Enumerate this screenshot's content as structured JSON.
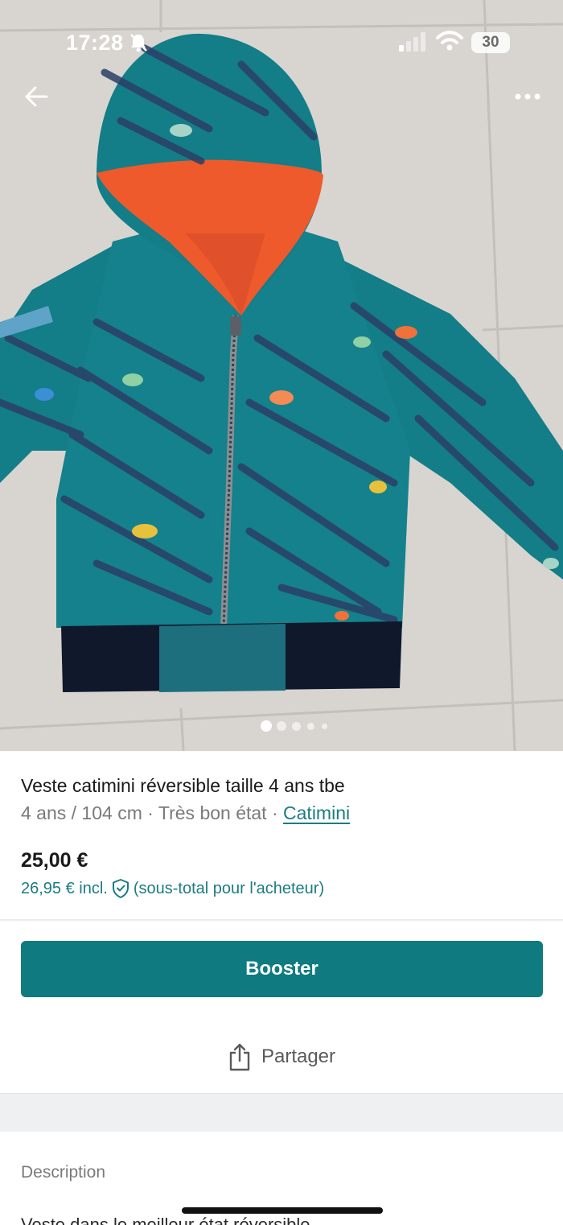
{
  "status_bar": {
    "time": "17:28",
    "battery": "30"
  },
  "photo": {
    "image_count": 5,
    "active_index": 0
  },
  "item": {
    "title": "Veste catimini réversible taille 4 ans tbe",
    "size": "4 ans / 104 cm",
    "separator": "·",
    "condition": "Très bon état",
    "brand": "Catimini",
    "price": "25,00 €",
    "price_incl": "26,95 € incl.",
    "price_incl_note": "(sous-total pour l'acheteur)"
  },
  "actions": {
    "booster_label": "Booster",
    "share_label": "Partager"
  },
  "description": {
    "label": "Description",
    "text": "Veste dans le meilleur état réversible"
  },
  "colors": {
    "accent": "#0f7a80",
    "link": "#1b7c82"
  },
  "icons": {
    "back": "arrow-left-icon",
    "more": "more-dots-icon",
    "share": "share-icon",
    "shield": "shield-check-icon",
    "bell": "bell-off-icon"
  }
}
